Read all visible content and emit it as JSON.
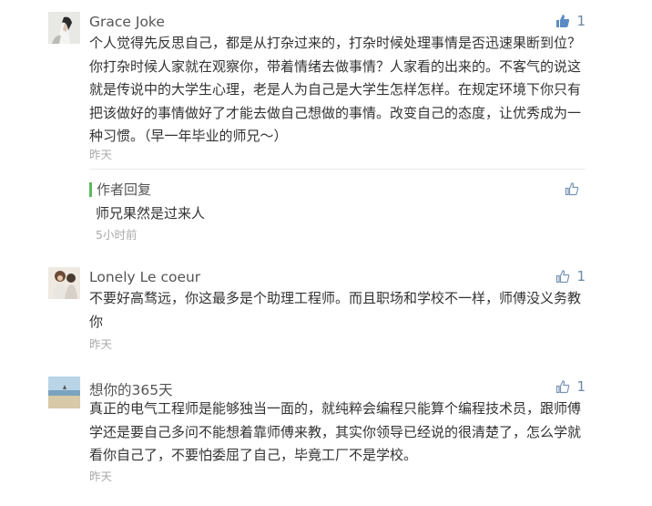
{
  "comments": [
    {
      "username": "Grace Joke",
      "likes": "1",
      "text": "个人觉得先反思自己，都是从打杂过来的，打杂时候处理事情是否迅速果断到位？你打杂时候人家就在观察你，带着情绪去做事情？人家看的出来的。不客气的说这就是传说中的大学生心理，老是人为自己是大学生怎样怎样。在规定环境下你只有把该做好的事情做好了才能去做自己想做的事情。改变自己的态度，让优秀成为一种习惯。（早一年毕业的师兄～）",
      "time": "昨天",
      "reply": {
        "label": "作者回复",
        "text": "师兄果然是过来人",
        "time": "5小时前"
      }
    },
    {
      "username": "Lonely Le coeur",
      "likes": "1",
      "text": "不要好高骛远，你这最多是个助理工程师。而且职场和学校不一样，师傅没义务教你",
      "time": "昨天"
    },
    {
      "username": "想你的365天",
      "likes": "1",
      "text": "真正的电气工程师是能够独当一面的，就纯粹会编程只能算个编程技术员，跟师傅学还是要自己多问不能想着靠师傅来教，其实你领导已经说的很清楚了，怎么学就看你自己了，不要怕委屈了自己，毕竟工厂不是学校。",
      "time": "昨天"
    }
  ],
  "colors": {
    "like_active": "#5b8bc4",
    "like_outline": "#7a95b5",
    "reply_bar": "#5cb85c"
  },
  "icons": {
    "like": "thumbs-up-icon"
  }
}
